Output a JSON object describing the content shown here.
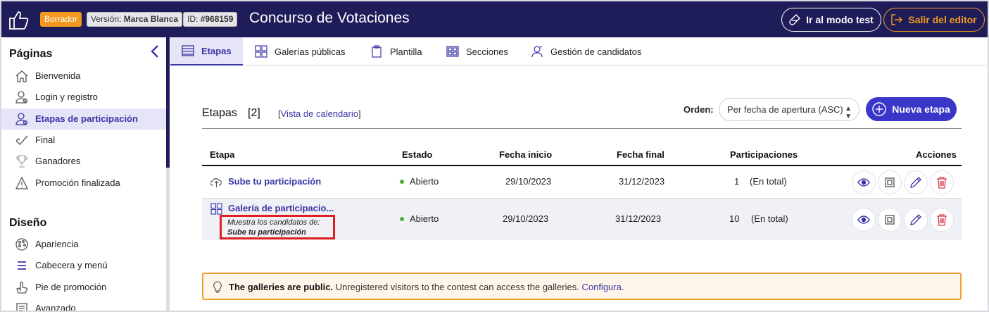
{
  "header": {
    "draft_badge": "Borrador",
    "version_label": "Versión:",
    "version_value": "Marca Blanca",
    "id_label": "ID:",
    "id_value": "#968159",
    "title": "Concurso de Votaciones",
    "test_mode_button": "Ir al modo test",
    "exit_button": "Salir del editor"
  },
  "sidebar": {
    "pages_heading": "Páginas",
    "pages": [
      {
        "label": "Bienvenida",
        "icon": "home-icon"
      },
      {
        "label": "Login y registro",
        "icon": "user-login-icon"
      },
      {
        "label": "Etapas de participación",
        "icon": "user-stages-icon",
        "active": true
      },
      {
        "label": "Final",
        "icon": "check-icon"
      },
      {
        "label": "Ganadores",
        "icon": "trophy-icon"
      },
      {
        "label": "Promoción finalizada",
        "icon": "warning-icon"
      }
    ],
    "design_heading": "Diseño",
    "design": [
      {
        "label": "Apariencia",
        "icon": "palette-icon"
      },
      {
        "label": "Cabecera y menú",
        "icon": "menu-icon"
      },
      {
        "label": "Pie de promoción",
        "icon": "hand-icon"
      },
      {
        "label": "Avanzado",
        "icon": "advanced-icon"
      }
    ]
  },
  "tabs": [
    {
      "label": "Etapas",
      "icon": "list-icon",
      "active": true
    },
    {
      "label": "Galerías públicas",
      "icon": "grid-icon"
    },
    {
      "label": "Plantilla",
      "icon": "clipboard-icon"
    },
    {
      "label": "Secciones",
      "icon": "sections-icon"
    },
    {
      "label": "Gestión de candidatos",
      "icon": "candidates-icon"
    }
  ],
  "stages": {
    "title": "Etapas",
    "count": "[2]",
    "calendar_link_open": "[",
    "calendar_link": "Vista de calendario",
    "calendar_link_close": "]",
    "order_label": "Orden:",
    "order_value": "Per fecha de apertura (ASC)",
    "new_button": "Nueva etapa",
    "columns": [
      "Etapa",
      "Estado",
      "Fecha inicio",
      "Fecha final",
      "Participaciones",
      "Acciones"
    ],
    "rows": [
      {
        "name": "Sube tu participación",
        "status": "Abierto",
        "start": "29/10/2023",
        "end": "31/12/2023",
        "count": "1",
        "count_note": "(En total)"
      },
      {
        "name": "Galería de participacio...",
        "status": "Abierto",
        "start": "29/10/2023",
        "end": "31/12/2023",
        "count": "10",
        "count_note": "(En total)",
        "note_prefix": "Muestra los candidatos de:",
        "note_value": "Sube tu participación"
      }
    ]
  },
  "alert": {
    "bold": "The galleries are public.",
    "text": " Unregistered visitors to the contest can access the galleries. ",
    "link": "Configura",
    "end": "."
  },
  "colors": {
    "header_bg": "#1f1c5a",
    "accent": "#3a36c8",
    "draft": "#f39a1e",
    "open_status": "#4cb035",
    "alert_border": "#f0a030",
    "highlight_box": "#e02020"
  }
}
